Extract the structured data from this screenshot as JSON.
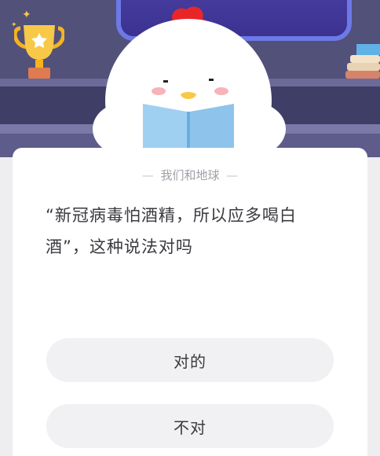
{
  "card": {
    "subtitle": "我们和地球",
    "subtitle_dash_left": "—",
    "subtitle_dash_right": "—",
    "question": "“新冠病毒怕酒精，所以应多喝白酒”，这种说法对吗"
  },
  "options": [
    {
      "label": "对的"
    },
    {
      "label": "不对"
    }
  ],
  "colors": {
    "scene_bg": "#52517a",
    "board_border": "#6d79e6",
    "card_bg": "#ffffff",
    "option_bg": "#f1f1f3",
    "text": "#3a3a3f",
    "subtitle": "#a0a0a8",
    "trophy_gold": "#f5b321",
    "mascot_comb": "#e8262a"
  },
  "icons": [
    "trophy-icon",
    "sparkle-icon",
    "books-icon",
    "chick-mascot"
  ]
}
